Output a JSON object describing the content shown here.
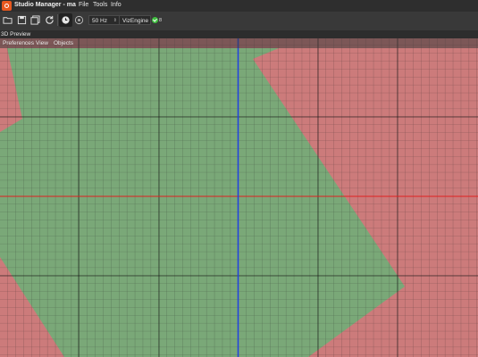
{
  "window": {
    "title": "Studio Manager - ma",
    "menu": [
      "File",
      "Tools",
      "Info"
    ]
  },
  "toolbar": {
    "buttons": [
      {
        "name": "open-folder-icon"
      },
      {
        "name": "save-icon"
      },
      {
        "name": "save-all-icon"
      },
      {
        "name": "refresh-icon"
      },
      {
        "name": "clock-icon"
      },
      {
        "name": "settings-disc-icon"
      }
    ],
    "frequency": "50 Hz",
    "engine": "VizEngine",
    "engine_count": "8",
    "engine_status_color": "#3fbf3f"
  },
  "panel": {
    "title": "3D Preview",
    "menu": [
      "Preferences",
      "View",
      "Objects"
    ]
  },
  "viewport": {
    "inside_color": "#7aa878",
    "outside_color": "#cc7b7b",
    "x_axis_color": "#e02020",
    "y_axis_color": "#2040e0"
  }
}
